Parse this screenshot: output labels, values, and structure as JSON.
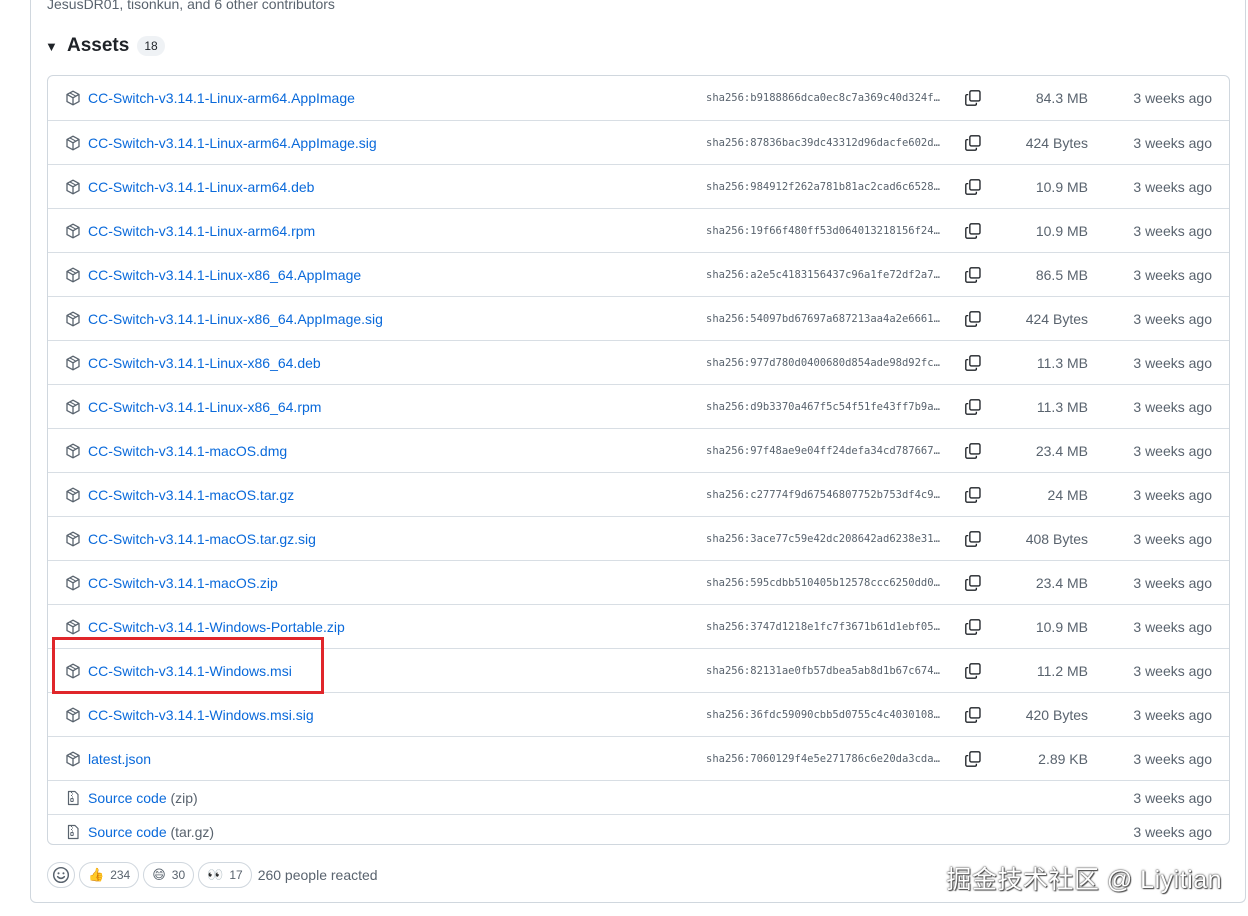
{
  "contributors": "JesusDR01, tisonkun, and 6 other contributors",
  "assets": {
    "title": "Assets",
    "count": "18",
    "items": [
      {
        "name": "CC-Switch-v3.14.1-Linux-arm64.AppImage",
        "sha": "sha256:b9188866dca0ec8c7a369c40d324f…",
        "size": "84.3 MB",
        "date": "3 weeks ago"
      },
      {
        "name": "CC-Switch-v3.14.1-Linux-arm64.AppImage.sig",
        "sha": "sha256:87836bac39dc43312d96dacfe602d…",
        "size": "424 Bytes",
        "date": "3 weeks ago"
      },
      {
        "name": "CC-Switch-v3.14.1-Linux-arm64.deb",
        "sha": "sha256:984912f262a781b81ac2cad6c6528…",
        "size": "10.9 MB",
        "date": "3 weeks ago"
      },
      {
        "name": "CC-Switch-v3.14.1-Linux-arm64.rpm",
        "sha": "sha256:19f66f480ff53d064013218156f24…",
        "size": "10.9 MB",
        "date": "3 weeks ago"
      },
      {
        "name": "CC-Switch-v3.14.1-Linux-x86_64.AppImage",
        "sha": "sha256:a2e5c4183156437c96a1fe72df2a7…",
        "size": "86.5 MB",
        "date": "3 weeks ago"
      },
      {
        "name": "CC-Switch-v3.14.1-Linux-x86_64.AppImage.sig",
        "sha": "sha256:54097bd67697a687213aa4a2e6661…",
        "size": "424 Bytes",
        "date": "3 weeks ago"
      },
      {
        "name": "CC-Switch-v3.14.1-Linux-x86_64.deb",
        "sha": "sha256:977d780d0400680d854ade98d92fc…",
        "size": "11.3 MB",
        "date": "3 weeks ago"
      },
      {
        "name": "CC-Switch-v3.14.1-Linux-x86_64.rpm",
        "sha": "sha256:d9b3370a467f5c54f51fe43ff7b9a…",
        "size": "11.3 MB",
        "date": "3 weeks ago"
      },
      {
        "name": "CC-Switch-v3.14.1-macOS.dmg",
        "sha": "sha256:97f48ae9e04ff24defa34cd787667…",
        "size": "23.4 MB",
        "date": "3 weeks ago"
      },
      {
        "name": "CC-Switch-v3.14.1-macOS.tar.gz",
        "sha": "sha256:c27774f9d67546807752b753df4c9…",
        "size": "24 MB",
        "date": "3 weeks ago"
      },
      {
        "name": "CC-Switch-v3.14.1-macOS.tar.gz.sig",
        "sha": "sha256:3ace77c59e42dc208642ad6238e31…",
        "size": "408 Bytes",
        "date": "3 weeks ago"
      },
      {
        "name": "CC-Switch-v3.14.1-macOS.zip",
        "sha": "sha256:595cdbb510405b12578ccc6250dd0…",
        "size": "23.4 MB",
        "date": "3 weeks ago"
      },
      {
        "name": "CC-Switch-v3.14.1-Windows-Portable.zip",
        "sha": "sha256:3747d1218e1fc7f3671b61d1ebf05…",
        "size": "10.9 MB",
        "date": "3 weeks ago"
      },
      {
        "name": "CC-Switch-v3.14.1-Windows.msi",
        "sha": "sha256:82131ae0fb57dbea5ab8d1b67c674…",
        "size": "11.2 MB",
        "date": "3 weeks ago"
      },
      {
        "name": "CC-Switch-v3.14.1-Windows.msi.sig",
        "sha": "sha256:36fdc59090cbb5d0755c4c4030108…",
        "size": "420 Bytes",
        "date": "3 weeks ago"
      },
      {
        "name": "latest.json",
        "sha": "sha256:7060129f4e5e271786c6e20da3cda…",
        "size": "2.89 KB",
        "date": "3 weeks ago"
      }
    ],
    "source": [
      {
        "label": "Source code",
        "suffix": "(zip)",
        "date": "3 weeks ago"
      },
      {
        "label": "Source code",
        "suffix": "(tar.gz)",
        "date": "3 weeks ago"
      }
    ]
  },
  "reactions": {
    "items": [
      {
        "emoji": "👍",
        "icon": "thumbs-up-icon",
        "count": "234"
      },
      {
        "emoji": "😄",
        "icon": "laugh-icon",
        "count": "30"
      },
      {
        "emoji": "👀",
        "icon": "eyes-icon",
        "count": "17"
      }
    ],
    "summary": "260 people reacted"
  },
  "watermark": "掘金技术社区 @ Liyitian",
  "colors": {
    "link": "#0969da",
    "muted": "#59636e",
    "border": "#d0d7de",
    "highlight": "#e0262a"
  }
}
